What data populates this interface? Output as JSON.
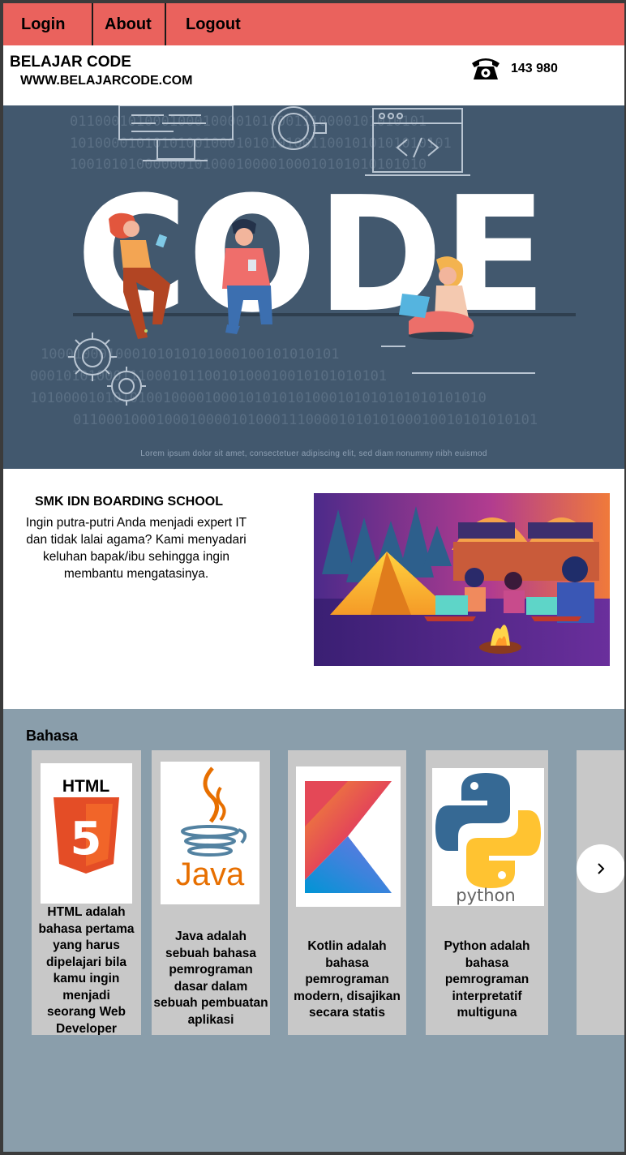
{
  "nav": {
    "items": [
      {
        "label": "Login"
      },
      {
        "label": "About"
      },
      {
        "label": "Logout"
      }
    ]
  },
  "header": {
    "brand_title": "BELAJAR CODE",
    "brand_url": "WWW.BELAJARCODE.COM",
    "phone_icon": "telephone-icon",
    "phone_number": "143 980"
  },
  "hero": {
    "word": "CODE",
    "binary_lines": [
      "0110001010001000100001010001110000101010101",
      "1010000101010100100010101010011001010101010101",
      "1001010100000010100010000100010101010101010",
      "100010001000101010101000100101010101",
      "0001010100011100010110010100010010101010101",
      "1010000101010100100001000101010101000101010101010101010",
      "01100010001000100001010001110000101010100010010101010101"
    ],
    "caption": "Lorem ipsum dolor sit amet, consectetuer adipiscing elit, sed diam nonummy nibh euismod"
  },
  "school": {
    "title": "SMK IDN BOARDING SCHOOL",
    "description": "Ingin putra-putri Anda menjadi expert IT dan tidak lalai agama? Kami menyadari keluhan bapak/ibu sehingga ingin membantu mengatasinya."
  },
  "languages": {
    "title": "Bahasa",
    "cards": [
      {
        "name": "HTML",
        "logo": "html5-logo",
        "text": "HTML adalah bahasa pertama yang harus dipelajari bila kamu ingin menjadi seorang Web Developer"
      },
      {
        "name": "Java",
        "logo": "java-logo",
        "text": "Java adalah sebuah bahasa pemrograman dasar dalam sebuah pembuatan aplikasi"
      },
      {
        "name": "Kotlin",
        "logo": "kotlin-logo",
        "text": "Kotlin adalah bahasa pemrograman modern, disajikan secara statis"
      },
      {
        "name": "Python",
        "logo": "python-logo",
        "text": "Python adalah bahasa pemrograman interpretatif multiguna"
      }
    ],
    "next_icon": "chevron-right-icon"
  },
  "colors": {
    "nav_bg": "#ea625d",
    "hero_bg": "#42586e",
    "section_bg": "#8a9eab",
    "card_bg": "#c8c8c8"
  }
}
